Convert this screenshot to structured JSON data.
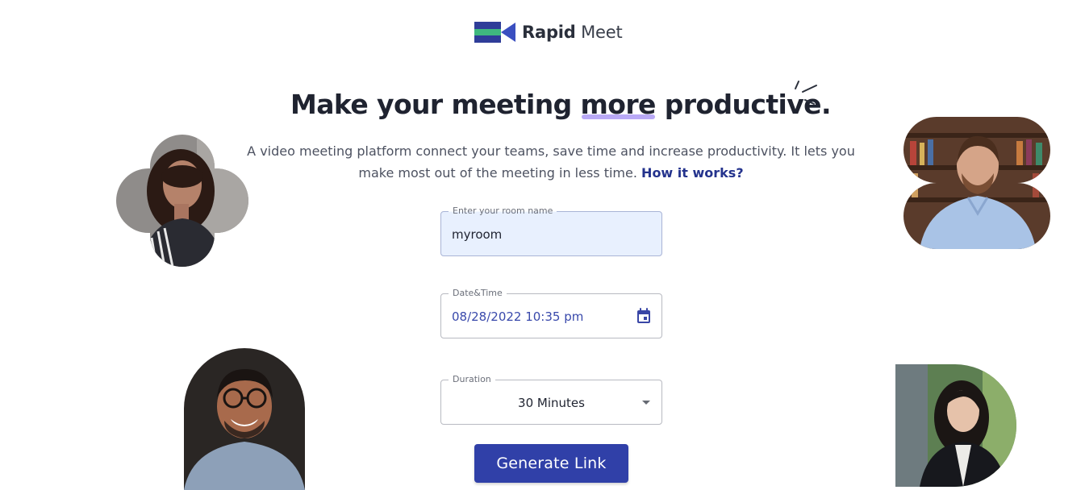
{
  "brand": {
    "name_bold": "Rapid",
    "name_light": "Meet",
    "logo_icon": "video-camera-icon",
    "colors": {
      "camera_body": "#2f3d99",
      "camera_stripe": "#3fb87f",
      "camera_lens": "#3a4fc0"
    }
  },
  "hero": {
    "headline_before": "Make your meeting ",
    "headline_highlight": "more",
    "headline_after": " productive.",
    "highlight_color": "#b9a9f6",
    "subtitle": "A video meeting platform connect your teams, save time and increase productivity. It lets you make most out of the meeting in less time.",
    "subtitle_link": "How it works?"
  },
  "form": {
    "room": {
      "label": "Enter your room name",
      "value": "myroom"
    },
    "datetime": {
      "label": "Date&Time",
      "value": "08/28/2022 10:35 pm",
      "icon": "calendar-icon"
    },
    "duration": {
      "label": "Duration",
      "value": "30 Minutes",
      "icon": "chevron-down-icon"
    },
    "submit_label": "Generate Link"
  },
  "colors": {
    "primary": "#3040a8",
    "link": "#24338d",
    "input_fill": "#e8f0fe"
  }
}
